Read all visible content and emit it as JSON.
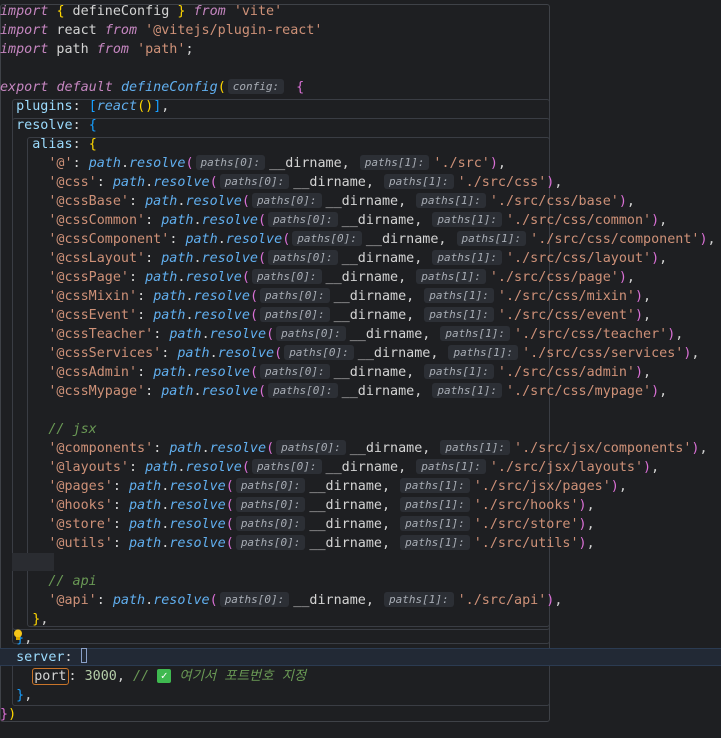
{
  "editor": {
    "file_language": "javascript",
    "lines": [
      [
        [
          "kw",
          "import"
        ],
        [
          "var",
          " "
        ],
        [
          "b1",
          "{"
        ],
        [
          "var",
          " defineConfig "
        ],
        [
          "b1",
          "}"
        ],
        [
          "var",
          " "
        ],
        [
          "kw",
          "from"
        ],
        [
          "var",
          " "
        ],
        [
          "str",
          "'vite'"
        ]
      ],
      [
        [
          "kw",
          "import"
        ],
        [
          "var",
          " react "
        ],
        [
          "kw",
          "from"
        ],
        [
          "var",
          " "
        ],
        [
          "str",
          "'@vitejs/plugin-react'"
        ]
      ],
      [
        [
          "kw",
          "import"
        ],
        [
          "var",
          " path "
        ],
        [
          "kw",
          "from"
        ],
        [
          "var",
          " "
        ],
        [
          "str",
          "'path'"
        ],
        [
          "var",
          ";"
        ]
      ],
      [],
      [
        [
          "kw",
          "export"
        ],
        [
          "var",
          " "
        ],
        [
          "kw",
          "default"
        ],
        [
          "var",
          " "
        ],
        [
          "ufn",
          "defineConfig"
        ],
        [
          "b1",
          "("
        ],
        [
          "hint",
          "config:"
        ],
        [
          "var",
          " "
        ],
        [
          "b2",
          "{"
        ]
      ],
      [
        [
          "var",
          "  "
        ],
        [
          "prop",
          "plugins"
        ],
        [
          "var",
          ": "
        ],
        [
          "b3",
          "["
        ],
        [
          "ufn",
          "react"
        ],
        [
          "b1",
          "()"
        ],
        [
          "b3",
          "]"
        ],
        [
          "var",
          ","
        ]
      ],
      [
        [
          "var",
          "  "
        ],
        [
          "prop",
          "resolve"
        ],
        [
          "var",
          ": "
        ],
        [
          "b3",
          "{"
        ]
      ],
      [
        [
          "var",
          "    "
        ],
        [
          "prop",
          "alias"
        ],
        [
          "var",
          ": "
        ],
        [
          "b1",
          "{"
        ]
      ],
      [
        [
          "var",
          "      "
        ],
        [
          "str",
          "'@'"
        ],
        [
          "var",
          ": "
        ],
        [
          "ufn",
          "path"
        ],
        [
          "var",
          "."
        ],
        [
          "ufn",
          "resolve"
        ],
        [
          "b2",
          "("
        ],
        [
          "hint",
          "paths[0]:"
        ],
        [
          "var",
          "__dirname, "
        ],
        [
          "hint",
          "paths[1]:"
        ],
        [
          "str",
          "'./src'"
        ],
        [
          "b2",
          ")"
        ],
        [
          "var",
          ","
        ]
      ],
      [
        [
          "var",
          "      "
        ],
        [
          "str",
          "'@css'"
        ],
        [
          "var",
          ": "
        ],
        [
          "ufn",
          "path"
        ],
        [
          "var",
          "."
        ],
        [
          "ufn",
          "resolve"
        ],
        [
          "b2",
          "("
        ],
        [
          "hint",
          "paths[0]:"
        ],
        [
          "var",
          "__dirname, "
        ],
        [
          "hint",
          "paths[1]:"
        ],
        [
          "str",
          "'./src/css'"
        ],
        [
          "b2",
          ")"
        ],
        [
          "var",
          ","
        ]
      ],
      [
        [
          "var",
          "      "
        ],
        [
          "str",
          "'@cssBase'"
        ],
        [
          "var",
          ": "
        ],
        [
          "ufn",
          "path"
        ],
        [
          "var",
          "."
        ],
        [
          "ufn",
          "resolve"
        ],
        [
          "b2",
          "("
        ],
        [
          "hint",
          "paths[0]:"
        ],
        [
          "var",
          "__dirname, "
        ],
        [
          "hint",
          "paths[1]:"
        ],
        [
          "str",
          "'./src/css/base'"
        ],
        [
          "b2",
          ")"
        ],
        [
          "var",
          ","
        ]
      ],
      [
        [
          "var",
          "      "
        ],
        [
          "str",
          "'@cssCommon'"
        ],
        [
          "var",
          ": "
        ],
        [
          "ufn",
          "path"
        ],
        [
          "var",
          "."
        ],
        [
          "ufn",
          "resolve"
        ],
        [
          "b2",
          "("
        ],
        [
          "hint",
          "paths[0]:"
        ],
        [
          "var",
          "__dirname, "
        ],
        [
          "hint",
          "paths[1]:"
        ],
        [
          "str",
          "'./src/css/common'"
        ],
        [
          "b2",
          ")"
        ],
        [
          "var",
          ","
        ]
      ],
      [
        [
          "var",
          "      "
        ],
        [
          "str",
          "'@cssComponent'"
        ],
        [
          "var",
          ": "
        ],
        [
          "ufn",
          "path"
        ],
        [
          "var",
          "."
        ],
        [
          "ufn",
          "resolve"
        ],
        [
          "b2",
          "("
        ],
        [
          "hint",
          "paths[0]:"
        ],
        [
          "var",
          "__dirname, "
        ],
        [
          "hint",
          "paths[1]:"
        ],
        [
          "str",
          "'./src/css/component'"
        ],
        [
          "b2",
          ")"
        ],
        [
          "var",
          ","
        ]
      ],
      [
        [
          "var",
          "      "
        ],
        [
          "str",
          "'@cssLayout'"
        ],
        [
          "var",
          ": "
        ],
        [
          "ufn",
          "path"
        ],
        [
          "var",
          "."
        ],
        [
          "ufn",
          "resolve"
        ],
        [
          "b2",
          "("
        ],
        [
          "hint",
          "paths[0]:"
        ],
        [
          "var",
          "__dirname, "
        ],
        [
          "hint",
          "paths[1]:"
        ],
        [
          "str",
          "'./src/css/layout'"
        ],
        [
          "b2",
          ")"
        ],
        [
          "var",
          ","
        ]
      ],
      [
        [
          "var",
          "      "
        ],
        [
          "str",
          "'@cssPage'"
        ],
        [
          "var",
          ": "
        ],
        [
          "ufn",
          "path"
        ],
        [
          "var",
          "."
        ],
        [
          "ufn",
          "resolve"
        ],
        [
          "b2",
          "("
        ],
        [
          "hint",
          "paths[0]:"
        ],
        [
          "var",
          "__dirname, "
        ],
        [
          "hint",
          "paths[1]:"
        ],
        [
          "str",
          "'./src/css/page'"
        ],
        [
          "b2",
          ")"
        ],
        [
          "var",
          ","
        ]
      ],
      [
        [
          "var",
          "      "
        ],
        [
          "str",
          "'@cssMixin'"
        ],
        [
          "var",
          ": "
        ],
        [
          "ufn",
          "path"
        ],
        [
          "var",
          "."
        ],
        [
          "ufn",
          "resolve"
        ],
        [
          "b2",
          "("
        ],
        [
          "hint",
          "paths[0]:"
        ],
        [
          "var",
          "__dirname, "
        ],
        [
          "hint",
          "paths[1]:"
        ],
        [
          "str",
          "'./src/css/mixin'"
        ],
        [
          "b2",
          ")"
        ],
        [
          "var",
          ","
        ]
      ],
      [
        [
          "var",
          "      "
        ],
        [
          "str",
          "'@cssEvent'"
        ],
        [
          "var",
          ": "
        ],
        [
          "ufn",
          "path"
        ],
        [
          "var",
          "."
        ],
        [
          "ufn",
          "resolve"
        ],
        [
          "b2",
          "("
        ],
        [
          "hint",
          "paths[0]:"
        ],
        [
          "var",
          "__dirname, "
        ],
        [
          "hint",
          "paths[1]:"
        ],
        [
          "str",
          "'./src/css/event'"
        ],
        [
          "b2",
          ")"
        ],
        [
          "var",
          ","
        ]
      ],
      [
        [
          "var",
          "      "
        ],
        [
          "str",
          "'@cssTeacher'"
        ],
        [
          "var",
          ": "
        ],
        [
          "ufn",
          "path"
        ],
        [
          "var",
          "."
        ],
        [
          "ufn",
          "resolve"
        ],
        [
          "b2",
          "("
        ],
        [
          "hint",
          "paths[0]:"
        ],
        [
          "var",
          "__dirname, "
        ],
        [
          "hint",
          "paths[1]:"
        ],
        [
          "str",
          "'./src/css/teacher'"
        ],
        [
          "b2",
          ")"
        ],
        [
          "var",
          ","
        ]
      ],
      [
        [
          "var",
          "      "
        ],
        [
          "str",
          "'@cssServices'"
        ],
        [
          "var",
          ": "
        ],
        [
          "ufn",
          "path"
        ],
        [
          "var",
          "."
        ],
        [
          "ufn",
          "resolve"
        ],
        [
          "b2",
          "("
        ],
        [
          "hint",
          "paths[0]:"
        ],
        [
          "var",
          "__dirname, "
        ],
        [
          "hint",
          "paths[1]:"
        ],
        [
          "str",
          "'./src/css/services'"
        ],
        [
          "b2",
          ")"
        ],
        [
          "var",
          ","
        ]
      ],
      [
        [
          "var",
          "      "
        ],
        [
          "str",
          "'@cssAdmin'"
        ],
        [
          "var",
          ": "
        ],
        [
          "ufn",
          "path"
        ],
        [
          "var",
          "."
        ],
        [
          "ufn",
          "resolve"
        ],
        [
          "b2",
          "("
        ],
        [
          "hint",
          "paths[0]:"
        ],
        [
          "var",
          "__dirname, "
        ],
        [
          "hint",
          "paths[1]:"
        ],
        [
          "str",
          "'./src/css/admin'"
        ],
        [
          "b2",
          ")"
        ],
        [
          "var",
          ","
        ]
      ],
      [
        [
          "var",
          "      "
        ],
        [
          "str",
          "'@cssMypage'"
        ],
        [
          "var",
          ": "
        ],
        [
          "ufn",
          "path"
        ],
        [
          "var",
          "."
        ],
        [
          "ufn",
          "resolve"
        ],
        [
          "b2",
          "("
        ],
        [
          "hint",
          "paths[0]:"
        ],
        [
          "var",
          "__dirname, "
        ],
        [
          "hint",
          "paths[1]:"
        ],
        [
          "str",
          "'./src/css/mypage'"
        ],
        [
          "b2",
          ")"
        ],
        [
          "var",
          ","
        ]
      ],
      [],
      [
        [
          "var",
          "      "
        ],
        [
          "cmt",
          "// jsx"
        ]
      ],
      [
        [
          "var",
          "      "
        ],
        [
          "str",
          "'@components'"
        ],
        [
          "var",
          ": "
        ],
        [
          "ufn",
          "path"
        ],
        [
          "var",
          "."
        ],
        [
          "ufn",
          "resolve"
        ],
        [
          "b2",
          "("
        ],
        [
          "hint",
          "paths[0]:"
        ],
        [
          "var",
          "__dirname, "
        ],
        [
          "hint",
          "paths[1]:"
        ],
        [
          "str",
          "'./src/jsx/components'"
        ],
        [
          "b2",
          ")"
        ],
        [
          "var",
          ","
        ]
      ],
      [
        [
          "var",
          "      "
        ],
        [
          "str",
          "'@layouts'"
        ],
        [
          "var",
          ": "
        ],
        [
          "ufn",
          "path"
        ],
        [
          "var",
          "."
        ],
        [
          "ufn",
          "resolve"
        ],
        [
          "b2",
          "("
        ],
        [
          "hint",
          "paths[0]:"
        ],
        [
          "var",
          "__dirname, "
        ],
        [
          "hint",
          "paths[1]:"
        ],
        [
          "str",
          "'./src/jsx/layouts'"
        ],
        [
          "b2",
          ")"
        ],
        [
          "var",
          ","
        ]
      ],
      [
        [
          "var",
          "      "
        ],
        [
          "str",
          "'@pages'"
        ],
        [
          "var",
          ": "
        ],
        [
          "ufn",
          "path"
        ],
        [
          "var",
          "."
        ],
        [
          "ufn",
          "resolve"
        ],
        [
          "b2",
          "("
        ],
        [
          "hint",
          "paths[0]:"
        ],
        [
          "var",
          "__dirname, "
        ],
        [
          "hint",
          "paths[1]:"
        ],
        [
          "str",
          "'./src/jsx/pages'"
        ],
        [
          "b2",
          ")"
        ],
        [
          "var",
          ","
        ]
      ],
      [
        [
          "var",
          "      "
        ],
        [
          "str",
          "'@hooks'"
        ],
        [
          "var",
          ": "
        ],
        [
          "ufn",
          "path"
        ],
        [
          "var",
          "."
        ],
        [
          "ufn",
          "resolve"
        ],
        [
          "b2",
          "("
        ],
        [
          "hint",
          "paths[0]:"
        ],
        [
          "var",
          "__dirname, "
        ],
        [
          "hint",
          "paths[1]:"
        ],
        [
          "str",
          "'./src/hooks'"
        ],
        [
          "b2",
          ")"
        ],
        [
          "var",
          ","
        ]
      ],
      [
        [
          "var",
          "      "
        ],
        [
          "str",
          "'@store'"
        ],
        [
          "var",
          ": "
        ],
        [
          "ufn",
          "path"
        ],
        [
          "var",
          "."
        ],
        [
          "ufn",
          "resolve"
        ],
        [
          "b2",
          "("
        ],
        [
          "hint",
          "paths[0]:"
        ],
        [
          "var",
          "__dirname, "
        ],
        [
          "hint",
          "paths[1]:"
        ],
        [
          "str",
          "'./src/store'"
        ],
        [
          "b2",
          ")"
        ],
        [
          "var",
          ","
        ]
      ],
      [
        [
          "var",
          "      "
        ],
        [
          "str",
          "'@utils'"
        ],
        [
          "var",
          ": "
        ],
        [
          "ufn",
          "path"
        ],
        [
          "var",
          "."
        ],
        [
          "ufn",
          "resolve"
        ],
        [
          "b2",
          "("
        ],
        [
          "hint",
          "paths[0]:"
        ],
        [
          "var",
          "__dirname, "
        ],
        [
          "hint",
          "paths[1]:"
        ],
        [
          "str",
          "'./src/utils'"
        ],
        [
          "b2",
          ")"
        ],
        [
          "var",
          ","
        ]
      ],
      [],
      [
        [
          "var",
          "      "
        ],
        [
          "cmt",
          "// api"
        ]
      ],
      [
        [
          "var",
          "      "
        ],
        [
          "str",
          "'@api'"
        ],
        [
          "var",
          ": "
        ],
        [
          "ufn",
          "path"
        ],
        [
          "var",
          "."
        ],
        [
          "ufn",
          "resolve"
        ],
        [
          "b2",
          "("
        ],
        [
          "hint",
          "paths[0]:"
        ],
        [
          "var",
          "__dirname, "
        ],
        [
          "hint",
          "paths[1]:"
        ],
        [
          "str",
          "'./src/api'"
        ],
        [
          "b2",
          ")"
        ],
        [
          "var",
          ","
        ]
      ],
      [
        [
          "var",
          "    "
        ],
        [
          "b1",
          "}"
        ],
        [
          "var",
          ","
        ]
      ],
      [
        [
          "var",
          "  "
        ],
        [
          "b3",
          "}"
        ],
        [
          "var",
          ","
        ]
      ],
      [
        [
          "var",
          "  "
        ],
        [
          "prop",
          "server"
        ],
        [
          "var",
          ": "
        ],
        [
          "cursor",
          ""
        ]
      ],
      [
        [
          "var",
          "    "
        ],
        [
          "portbox",
          "port"
        ],
        [
          "var",
          ": "
        ],
        [
          "num",
          "3000"
        ],
        [
          "var",
          ", "
        ],
        [
          "cmt",
          "// "
        ],
        [
          "check",
          "✓"
        ],
        [
          "cmt",
          " 여기서 포트번호 지정"
        ]
      ],
      [
        [
          "var",
          "  "
        ],
        [
          "b3",
          "}"
        ],
        [
          "var",
          ","
        ]
      ],
      [
        [
          "b2",
          "}"
        ],
        [
          "b1",
          ")"
        ]
      ]
    ]
  }
}
